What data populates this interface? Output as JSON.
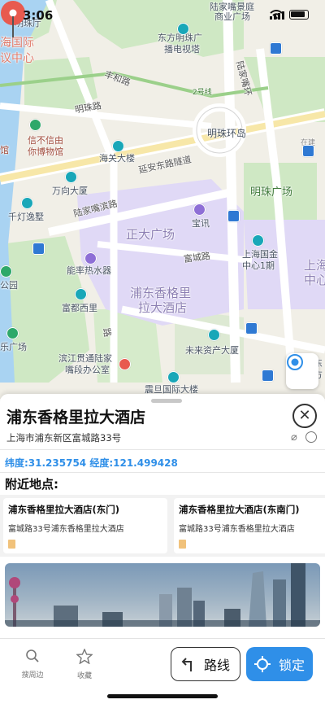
{
  "status_bar": {
    "time": "3:06"
  },
  "map": {
    "labels": {
      "l_mingzhuting": "明珠厅",
      "l_lujiazui_scenic": "陆家嘴景庭",
      "l_shangye_guang": "商业广场",
      "l_hai_guoji": "海国际",
      "l_yi_zhongxin": "议中心",
      "l_dongfang": "东方明珠广",
      "l_bodianshita": "播电视塔",
      "l_line2": "2号线",
      "l_fenghelu": "丰和路",
      "l_lujiazui_hx": "陆家嘴环",
      "l_lu": "路",
      "l_mingzhulu": "明珠路",
      "l_mingzhu_island": "明珠环岛",
      "l_xinbuxinyou": "信不信由",
      "l_ni_bowuguan": "你博物馆",
      "l_guan": "馆",
      "l_haiguan": "海关大楼",
      "l_yanan": "延安东路隧道",
      "l_wanxiang": "万向大厦",
      "l_mingzhu_gc": "明珠广场",
      "l_zaixin": "在建",
      "l_qiandeng": "千灯逸墅",
      "l_lujiazuibin": "陆家嘴滨路",
      "l_zhengda": "正大广场",
      "l_baoxun": "宝讯",
      "l_shanghai_ifc1": "上海国金",
      "l_shanghai_ifc2": "中心1期",
      "l_shanghai_ifc3": "上海",
      "l_shanghai_ifc4": "中心",
      "l_gongyuan": "公园",
      "l_nengre": "能率热水器",
      "l_fudu": "富都西里",
      "l_pudong_hotel1": "浦东香格里",
      "l_pudong_hotel2": "拉大酒店",
      "l_funa": "富城路",
      "l_gc": "乐广场",
      "l_weilai": "未来资产大厦",
      "l_binjiang1": "滨江贯通陆家",
      "l_binjiang2": "嘴段办公室",
      "l_zhendan": "震旦国际大楼",
      "l_dong": "东",
      "l_jia": "方",
      "l_cheng": "路",
      "l_zhenglu": "路"
    }
  },
  "place": {
    "name": "浦东香格里拉大酒店",
    "address": "上海市浦东新区富城路33号",
    "coords": "纬度:31.235754 经度:121.499428"
  },
  "nearby": {
    "title": "附近地点:",
    "items": [
      {
        "name": "浦东香格里拉大酒店(东门)",
        "address": "富城路33号浦东香格里拉大酒店"
      },
      {
        "name": "浦东香格里拉大酒店(东南门)",
        "address": "富城路33号浦东香格里拉大酒店"
      }
    ]
  },
  "bottom_bar": {
    "tab_search": "搜周边",
    "tab_favorite": "收藏",
    "route_label": "路线",
    "lock_label": "锁定"
  },
  "colors": {
    "accent": "#2f8fe8",
    "pin": "#e85a4f"
  }
}
